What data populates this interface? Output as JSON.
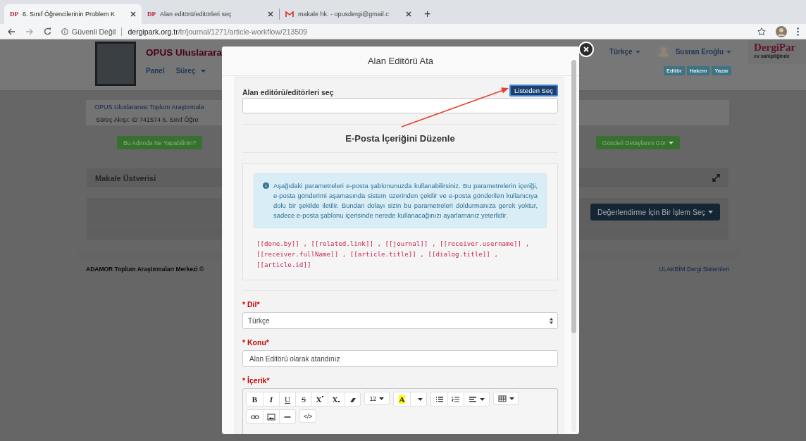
{
  "browser": {
    "tabs": [
      {
        "kind": "dp",
        "icon_text": "DP",
        "title": "6. Sınıf Öğrencilerinin Problem K",
        "selected": true
      },
      {
        "kind": "dp",
        "icon_text": "DP",
        "title": "Alan editörü/editörleri seç",
        "selected": false
      },
      {
        "kind": "mail",
        "title": "makale hk. - opusdergi@gmail.c",
        "selected": false
      }
    ],
    "new_tab": "+",
    "security": "Güvenli Değil",
    "url": "**dergipark.org.tr**/tr/journal/1271/article-workflow/213509"
  },
  "journal": {
    "title": "OPUS Uluslarara",
    "nav": [
      {
        "label": "Panel",
        "dropdown": false
      },
      {
        "label": "Süreç",
        "dropdown": true
      }
    ]
  },
  "user_menu": {
    "language": "Türkçe",
    "user": "Susran Eroğlu",
    "roles": [
      "Editör",
      "Hakem",
      "Yazar"
    ]
  },
  "brand": {
    "name": "DergiPar",
    "tagline": "ev sahipliğinde"
  },
  "breadcrumb": [
    "OPUS Uluslararası Toplum Araştırmala",
    "Süreç Akışı: ID 741574 6. Sınıf Öğre"
  ],
  "actions": [
    {
      "label": "Bu Adımda Ne Yapabilirim?",
      "dropdown": false
    },
    {
      "label": "Gönderi Detaylarını Gör",
      "dropdown": true
    }
  ],
  "metadata_panel": {
    "title": "Makale Üstverisi"
  },
  "review_action": {
    "label": "Değerlendirme İçin Bir İşlem Seç",
    "dropdown": true
  },
  "footer": {
    "left": "ADAMOR Toplum Araştırmaları Merkezi ©",
    "right": "ULAKBİM Dergi Sistemleri"
  },
  "modal": {
    "title": "Alan Editörü Ata",
    "editor_field": {
      "label": "Alan editörü/editörleri seç",
      "button": "Listeden Seç"
    },
    "section_title": "E-Posta İçeriğini Düzenle",
    "info": "Aşağıdaki parametreleri e-posta şablonunuzda kullanabilirsiniz. Bu parametrelerin içeriği, e-posta gönderimi aşamasında sistem üzerinden çekilir ve e-posta gönderilen kullanıcıya dolu bir şekilde iletilir. Bundan dolayı sizin bu parametreleri doldurmanıza gerek yoktur, sadece e-posta şablonu içerisinde nerede kullanacağınızı ayarlamanız yeterlidir.",
    "params": "[[done.by]] , [[related.link]] , [[journal]] , [[receiver.username]] , [[receiver.fullName]] , [[article.title]] , [[dialog.title]] , [[article.id]]",
    "fields": [
      {
        "kind": "select",
        "label": "* Dil*",
        "value": "Türkçe"
      },
      {
        "kind": "text",
        "label": "* Konu*",
        "value": "Alan Editörü olarak atandınız"
      },
      {
        "kind": "editor",
        "label": "* İçerik*",
        "toolbar": [
          [
            [
              {
                "kind": "bold",
                "label": "B"
              },
              {
                "kind": "italic",
                "label": "I"
              },
              {
                "kind": "underline",
                "label": "U"
              },
              {
                "kind": "strike",
                "label": "S"
              },
              {
                "kind": "superscript",
                "label": "X"
              },
              {
                "kind": "subscript",
                "label": "X"
              },
              {
                "kind": "eraser"
              }
            ],
            [
              {
                "kind": "fontsize",
                "label": "12"
              }
            ],
            [
              {
                "kind": "highlight",
                "label": "A"
              },
              {
                "kind": "caret"
              }
            ],
            [
              {
                "kind": "ul"
              },
              {
                "kind": "ol"
              },
              {
                "kind": "align"
              }
            ],
            [
              {
                "kind": "table"
              }
            ]
          ],
          [
            [
              {
                "kind": "link"
              },
              {
                "kind": "image"
              },
              {
                "kind": "rule"
              }
            ],
            [
              {
                "kind": "code",
                "label": "</>"
              }
            ]
          ]
        ]
      }
    ]
  }
}
